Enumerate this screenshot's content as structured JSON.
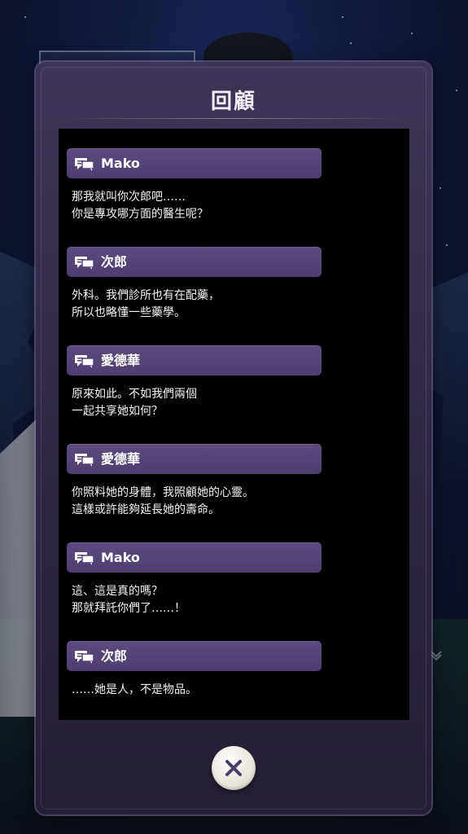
{
  "dialog": {
    "title": "回顧",
    "close_icon": "close-x-icon"
  },
  "entries": [
    {
      "speaker": "Mako",
      "lines": [
        "那我就叫你次郎吧……",
        "你是專攻哪方面的醫生呢？"
      ]
    },
    {
      "speaker": "次郎",
      "lines": [
        "外科。我們診所也有在配藥，",
        "所以也略懂一些藥學。"
      ]
    },
    {
      "speaker": "愛德華",
      "lines": [
        "原來如此。不如我們兩個",
        "一起共享她如何？"
      ]
    },
    {
      "speaker": "愛德華",
      "lines": [
        "你照料她的身體，我照顧她的心靈。",
        "這樣或許能夠延長她的壽命。"
      ]
    },
    {
      "speaker": "Mako",
      "lines": [
        "這、這是真的嗎？",
        "那就拜託你們了……！"
      ]
    },
    {
      "speaker": "次郎",
      "lines": [
        "……她是人，不是物品。"
      ]
    }
  ],
  "icons": {
    "speaker_icon": "chat-bubbles-icon"
  },
  "colors": {
    "panel": "#2d2640",
    "speaker_bar": "#54437a",
    "log_background": "#000000",
    "text": "#f3f3f3"
  }
}
